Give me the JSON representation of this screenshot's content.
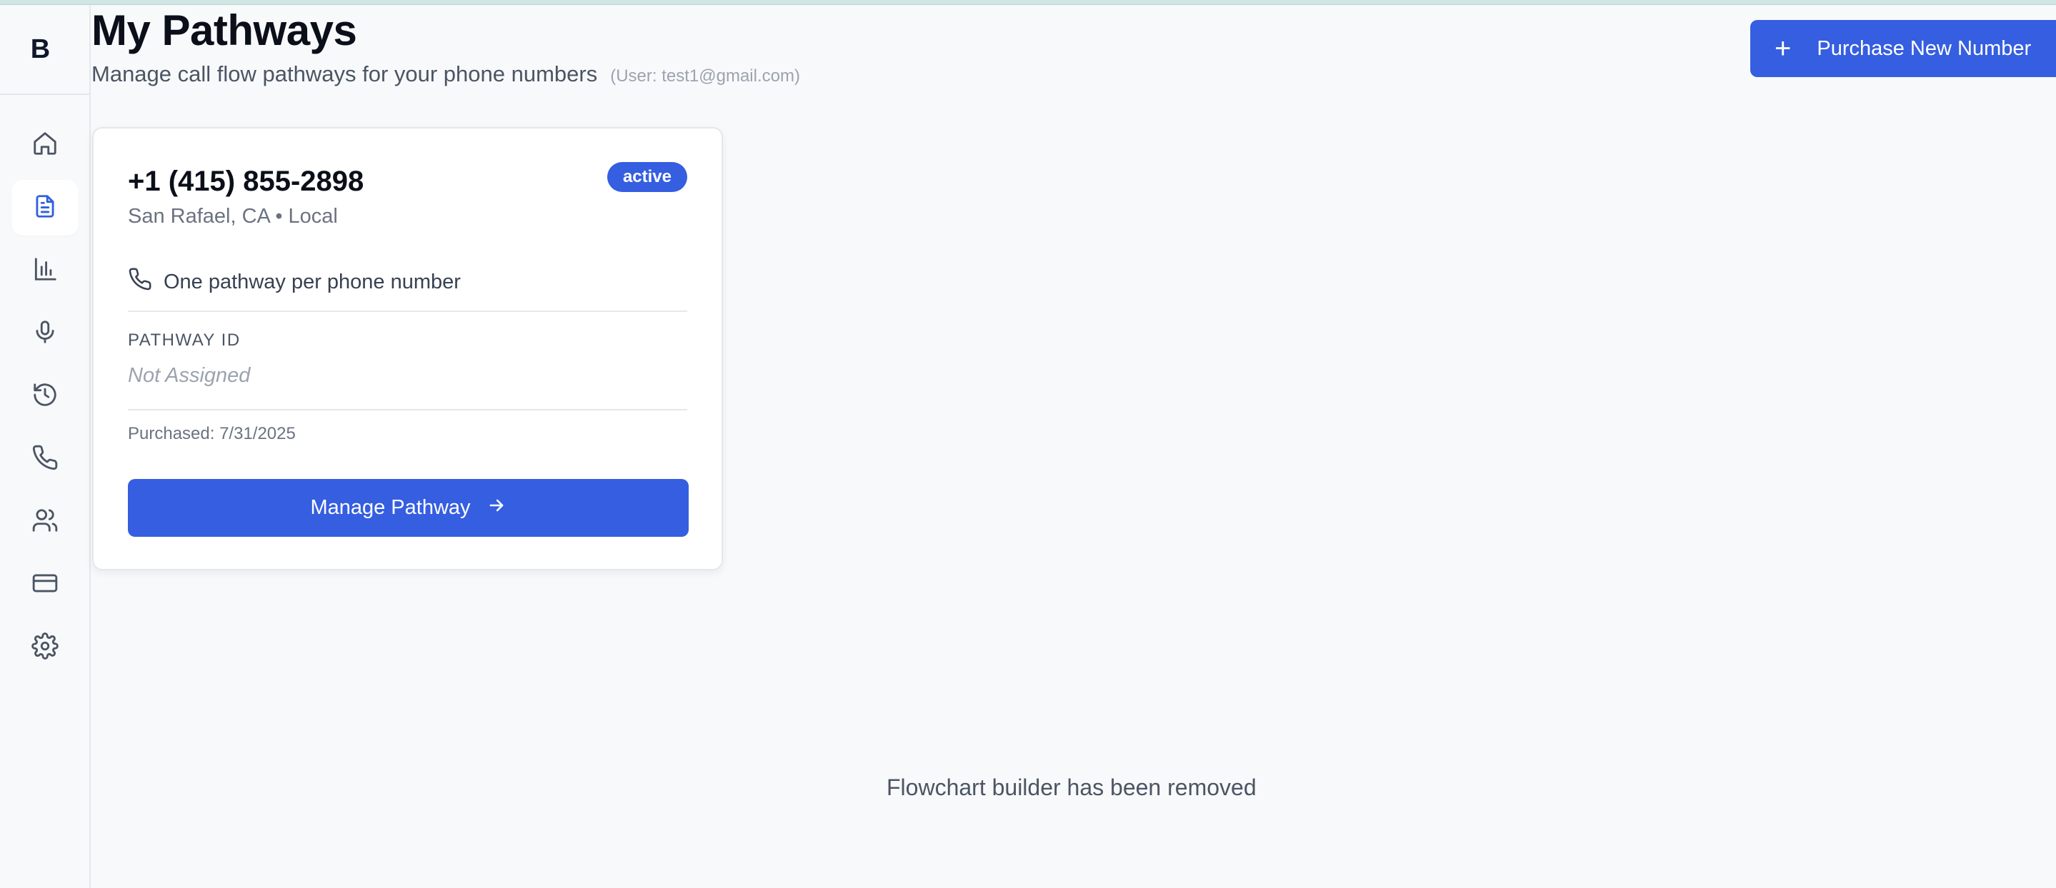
{
  "app": {
    "logo": "B"
  },
  "sidebar": {
    "items": [
      {
        "icon": "home-icon",
        "active": false
      },
      {
        "icon": "document-icon",
        "active": true
      },
      {
        "icon": "bar-chart-icon",
        "active": false
      },
      {
        "icon": "microphone-icon",
        "active": false
      },
      {
        "icon": "history-icon",
        "active": false
      },
      {
        "icon": "phone-icon",
        "active": false
      },
      {
        "icon": "users-icon",
        "active": false
      },
      {
        "icon": "credit-card-icon",
        "active": false
      },
      {
        "icon": "gear-icon",
        "active": false
      }
    ]
  },
  "header": {
    "title": "My Pathways",
    "subtitle": "Manage call flow pathways for your phone numbers",
    "user": "(User: test1@gmail.com)",
    "purchase_button": {
      "icon": "plus-icon",
      "label": "Purchase New Number"
    }
  },
  "card": {
    "phone_number": "+1 (415) 855-2898",
    "location": "San Rafael, CA • Local",
    "status": "active",
    "note": "One pathway per phone number",
    "pathway_id_label": "PATHWAY ID",
    "pathway_id_value": "Not Assigned",
    "purchased": "Purchased: 7/31/2025",
    "manage_button": "Manage Pathway"
  },
  "main": {
    "message": "Flowchart builder has been removed"
  },
  "colors": {
    "accent": "#355ee0",
    "background": "#f8f9fb"
  }
}
